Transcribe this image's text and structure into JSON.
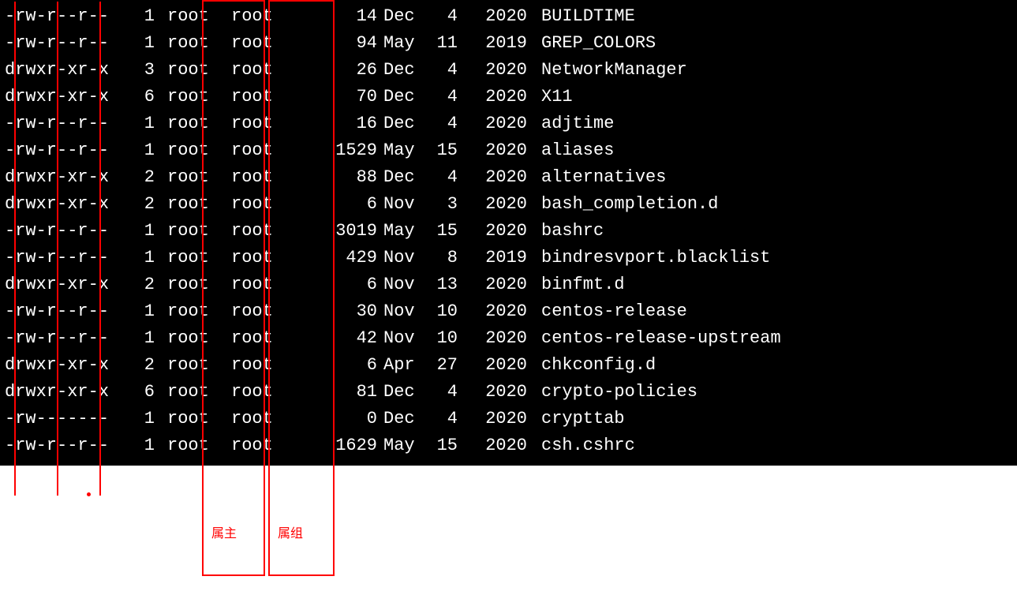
{
  "annotations": {
    "owner_label": "属主",
    "group_label": "属组"
  },
  "files": [
    {
      "perms": "-rw-r--r--",
      "links": "1",
      "owner": "root",
      "group": "root",
      "size": "14",
      "month": "Dec",
      "day": "4",
      "year": "2020",
      "name": "BUILDTIME"
    },
    {
      "perms": "-rw-r--r--",
      "links": "1",
      "owner": "root",
      "group": "root",
      "size": "94",
      "month": "May",
      "day": "11",
      "year": "2019",
      "name": "GREP_COLORS"
    },
    {
      "perms": "drwxr-xr-x",
      "links": "3",
      "owner": "root",
      "group": "root",
      "size": "26",
      "month": "Dec",
      "day": "4",
      "year": "2020",
      "name": "NetworkManager"
    },
    {
      "perms": "drwxr-xr-x",
      "links": "6",
      "owner": "root",
      "group": "root",
      "size": "70",
      "month": "Dec",
      "day": "4",
      "year": "2020",
      "name": "X11"
    },
    {
      "perms": "-rw-r--r--",
      "links": "1",
      "owner": "root",
      "group": "root",
      "size": "16",
      "month": "Dec",
      "day": "4",
      "year": "2020",
      "name": "adjtime"
    },
    {
      "perms": "-rw-r--r--",
      "links": "1",
      "owner": "root",
      "group": "root",
      "size": "1529",
      "month": "May",
      "day": "15",
      "year": "2020",
      "name": "aliases"
    },
    {
      "perms": "drwxr-xr-x",
      "links": "2",
      "owner": "root",
      "group": "root",
      "size": "88",
      "month": "Dec",
      "day": "4",
      "year": "2020",
      "name": "alternatives"
    },
    {
      "perms": "drwxr-xr-x",
      "links": "2",
      "owner": "root",
      "group": "root",
      "size": "6",
      "month": "Nov",
      "day": "3",
      "year": "2020",
      "name": "bash_completion.d"
    },
    {
      "perms": "-rw-r--r--",
      "links": "1",
      "owner": "root",
      "group": "root",
      "size": "3019",
      "month": "May",
      "day": "15",
      "year": "2020",
      "name": "bashrc"
    },
    {
      "perms": "-rw-r--r--",
      "links": "1",
      "owner": "root",
      "group": "root",
      "size": "429",
      "month": "Nov",
      "day": "8",
      "year": "2019",
      "name": "bindresvport.blacklist"
    },
    {
      "perms": "drwxr-xr-x",
      "links": "2",
      "owner": "root",
      "group": "root",
      "size": "6",
      "month": "Nov",
      "day": "13",
      "year": "2020",
      "name": "binfmt.d"
    },
    {
      "perms": "-rw-r--r--",
      "links": "1",
      "owner": "root",
      "group": "root",
      "size": "30",
      "month": "Nov",
      "day": "10",
      "year": "2020",
      "name": "centos-release"
    },
    {
      "perms": "-rw-r--r--",
      "links": "1",
      "owner": "root",
      "group": "root",
      "size": "42",
      "month": "Nov",
      "day": "10",
      "year": "2020",
      "name": "centos-release-upstream"
    },
    {
      "perms": "drwxr-xr-x",
      "links": "2",
      "owner": "root",
      "group": "root",
      "size": "6",
      "month": "Apr",
      "day": "27",
      "year": "2020",
      "name": "chkconfig.d"
    },
    {
      "perms": "drwxr-xr-x",
      "links": "6",
      "owner": "root",
      "group": "root",
      "size": "81",
      "month": "Dec",
      "day": "4",
      "year": "2020",
      "name": "crypto-policies"
    },
    {
      "perms": "-rw-------",
      "links": "1",
      "owner": "root",
      "group": "root",
      "size": "0",
      "month": "Dec",
      "day": "4",
      "year": "2020",
      "name": "crypttab"
    },
    {
      "perms": "-rw-r--r--",
      "links": "1",
      "owner": "root",
      "group": "root",
      "size": "1629",
      "month": "May",
      "day": "15",
      "year": "2020",
      "name": "csh.cshrc"
    }
  ]
}
